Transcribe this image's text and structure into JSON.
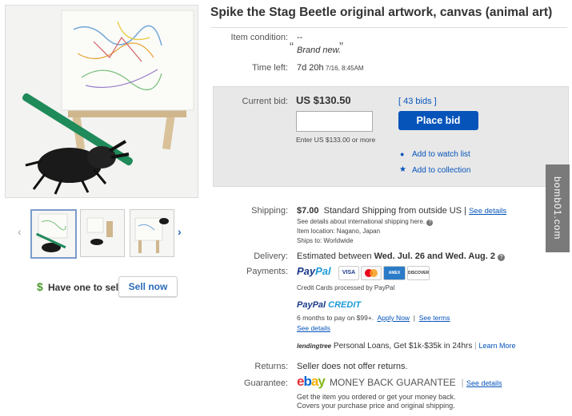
{
  "item": {
    "title": "Spike the Stag Beetle original artwork, canvas (animal art)"
  },
  "details": {
    "condition_label": "Item condition:",
    "condition_value": "--",
    "condition_quote": "Brand new.",
    "time_left_label": "Time left:",
    "time_left_value": "7d 20h",
    "time_left_end": "7/16, 8:45AM"
  },
  "bid": {
    "current_bid_label": "Current bid:",
    "current_bid_value": "US $130.50",
    "bids_count": "[ 43 bids ]",
    "input_placeholder": "",
    "min_bid_hint": "Enter US $133.00 or more",
    "place_bid_label": "Place bid",
    "watch_label": "Add to watch list",
    "collection_label": "Add to collection"
  },
  "shipping": {
    "label": "Shipping:",
    "cost": "$7.00",
    "method": "Standard Shipping from outside US",
    "sep": "|",
    "see_details": "See details",
    "intl_note": "See details about international shipping here.",
    "item_location": "Item location:  Nagano, Japan",
    "ships_to": "Ships to:  Worldwide"
  },
  "delivery": {
    "label": "Delivery:",
    "prefix": "Estimated between",
    "dates": "Wed. Jul. 26 and Wed. Aug. 2"
  },
  "payments": {
    "label": "Payments:",
    "paypal_a": "Pay",
    "paypal_b": "Pal",
    "cards": [
      "VISA",
      "MC",
      "AMEX",
      "DISCOVER"
    ],
    "processed_note": "Credit Cards processed by PayPal",
    "credit_a": "PayPal",
    "credit_b": "CREDIT",
    "credit_terms": "6 months to pay on $99+.",
    "apply_now": "Apply Now",
    "see_terms": "See terms",
    "see_details": "See details",
    "lending_brand": "lendingtree",
    "lending_text": "Personal Loans, Get $1k-$35k in 24hrs",
    "learn_more": "Learn More"
  },
  "returns": {
    "label": "Returns:",
    "value": "Seller does not offer returns."
  },
  "guarantee": {
    "label": "Guarantee:",
    "ebay": "ebay",
    "name": "MONEY BACK GUARANTEE",
    "see_details": "See details",
    "line1": "Get the item you ordered or get your money back.",
    "line2": "Covers your purchase price and original shipping."
  },
  "seller_prompt": {
    "dollar": "$",
    "question": "Have one to sell?",
    "button": "Sell now"
  },
  "watermark": "bomb01.com",
  "colors": {
    "accent_blue": "#0654ba",
    "paypal_dark": "#1a3a8a",
    "paypal_light": "#1d9bd9",
    "ebay_red": "#e53238",
    "ebay_blue": "#0064d2",
    "ebay_yellow": "#f5af02",
    "ebay_green": "#86b817"
  }
}
